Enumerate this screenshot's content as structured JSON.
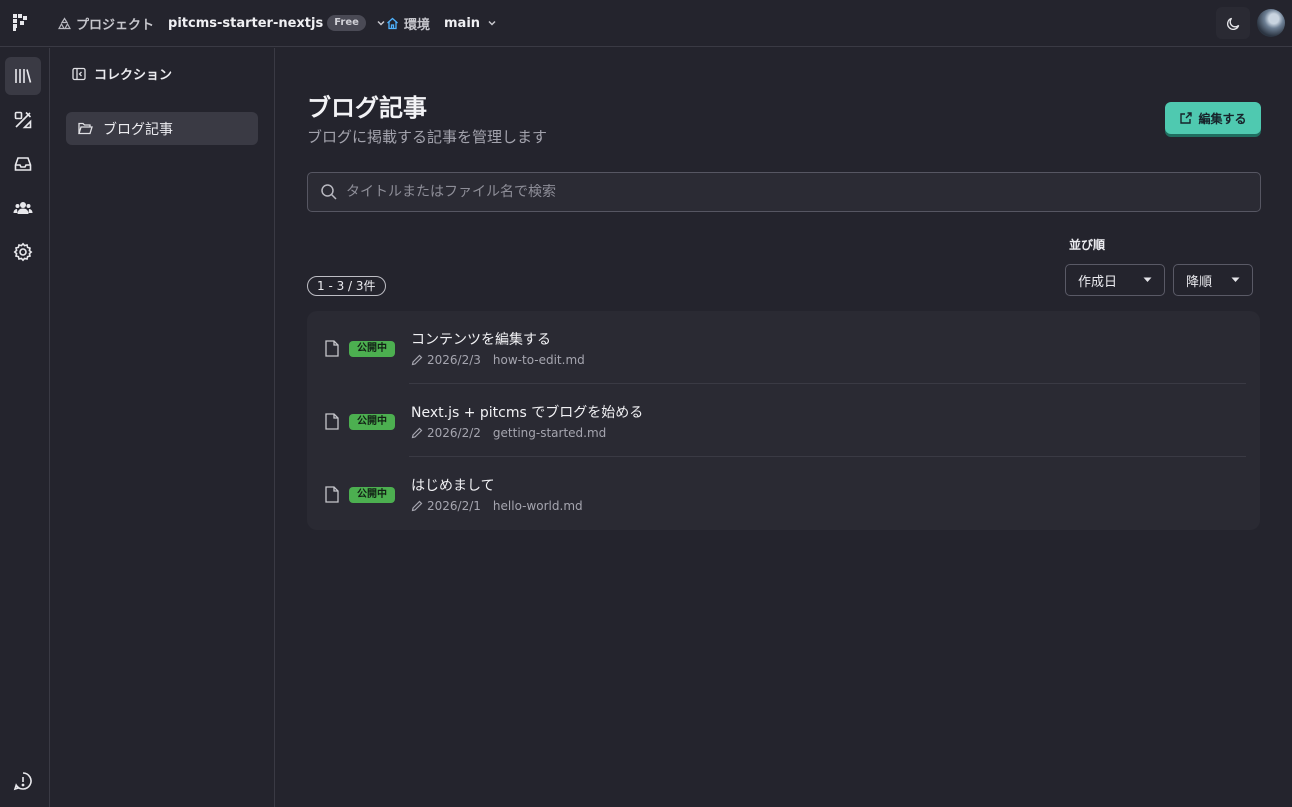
{
  "header": {
    "project_label": "プロジェクト",
    "project_name": "pitcms-starter-nextjs",
    "plan_badge": "Free",
    "env_label": "環境",
    "env_name": "main"
  },
  "rail": {
    "items": [
      "library-icon",
      "design-tools-icon",
      "inbox-icon",
      "users-icon",
      "settings-icon"
    ],
    "bottom": "feedback-icon"
  },
  "sidebar": {
    "heading": "コレクション",
    "items": [
      {
        "label": "ブログ記事"
      }
    ]
  },
  "main": {
    "title": "ブログ記事",
    "subtitle": "ブログに掲載する記事を管理します",
    "edit_button": "編集する",
    "search_placeholder": "タイトルまたはファイル名で検索",
    "sort_label": "並び順",
    "sort_field": "作成日",
    "sort_order": "降順",
    "count": "1 - 3 / 3件"
  },
  "entries": [
    {
      "status": "公開中",
      "title": "コンテンツを編集する",
      "date": "2026/2/3",
      "file": "how-to-edit.md"
    },
    {
      "status": "公開中",
      "title": "Next.js + pitcms でブログを始める",
      "date": "2026/2/2",
      "file": "getting-started.md"
    },
    {
      "status": "公開中",
      "title": "はじめまして",
      "date": "2026/2/1",
      "file": "hello-world.md"
    }
  ],
  "colors": {
    "background": "#24242d",
    "accent": "#4fc9b0",
    "status_published": "#4caf50"
  }
}
